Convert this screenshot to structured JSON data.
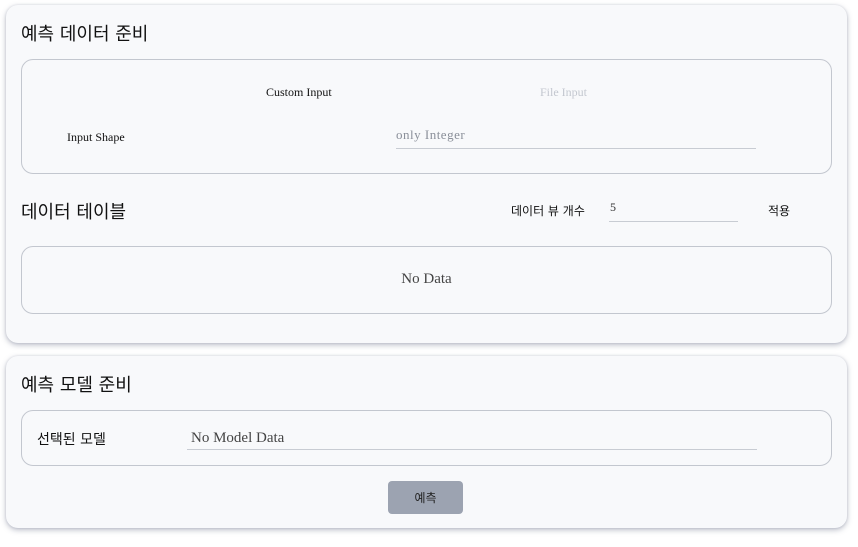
{
  "prep_section": {
    "title": "예측 데이터 준비",
    "tabs": [
      {
        "label": "Custom Input",
        "active": true
      },
      {
        "label": "File Input",
        "active": false
      }
    ],
    "input_shape_label": "Input Shape",
    "input_shape_placeholder": "only Integer"
  },
  "table_section": {
    "title": "데이터 테이블",
    "view_count_label": "데이터 뷰 개수",
    "view_count_value": "5",
    "apply_label": "적용",
    "empty_text": "No Data"
  },
  "model_section": {
    "title": "예측 모델 준비",
    "selected_model_label": "선택된 모델",
    "selected_model_value": "No Model Data",
    "predict_button_label": "예측"
  },
  "colors": {
    "card_bg": "#f8f9fb",
    "border": "#c3c7cf",
    "inactive_tab": "#c3c7cf",
    "button_bg": "#9ca3b1"
  }
}
